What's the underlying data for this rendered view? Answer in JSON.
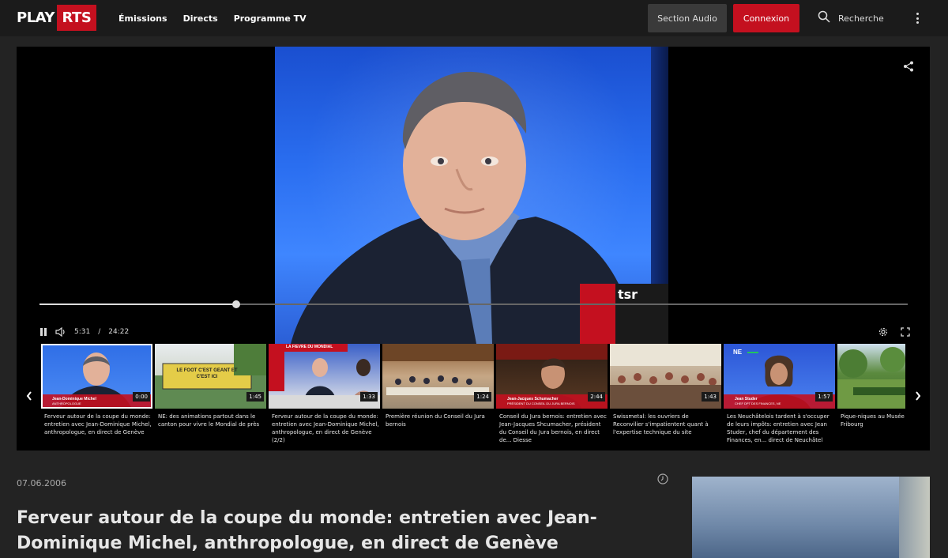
{
  "header": {
    "logo_play": "PLAY",
    "logo_rts": "RTS",
    "nav": [
      "Émissions",
      "Directs",
      "Programme TV"
    ],
    "audio_label": "Section Audio",
    "login_label": "Connexion",
    "search_label": "Recherche"
  },
  "player": {
    "time_current": "5:31",
    "time_separator": "/",
    "time_total": "24:22",
    "progress": 0.227,
    "channel_logo": "tsr"
  },
  "carousel": [
    {
      "title": "Ferveur autour de la coupe du monde: entretien avec Jean-Dominique Michel, anthropologue, en direct de Genève",
      "duration": "0:00",
      "lower_third": "Jean-Dominique Michel",
      "lower_third_sub": "ANTHROPOLOGUE",
      "active": true
    },
    {
      "title": "NE: des animations partout dans le canton pour vivre le Mondial de près",
      "duration": "1:45",
      "banner": "LE FOOT C'EST GEANT ET C'EST ICI"
    },
    {
      "title": "Ferveur autour de la coupe du monde: entretien avec Jean-Dominique Michel, anthropologue, en direct de Genève (2/2)",
      "duration": "1:33",
      "banner": "LA FIEVRE DU MONDIAL"
    },
    {
      "title": "Première réunion du Conseil du Jura bernois",
      "duration": "1:24"
    },
    {
      "title": "Conseil du Jura bernois: entretien avec Jean-Jacques Shcumacher, président du Conseil du Jura bernois, en direct de... Diesse",
      "duration": "2:44",
      "lower_third": "Jean-Jacques Schumacher",
      "lower_third_sub": "PRÉSIDENT DU CONSEIL DU JURA BERNOIS"
    },
    {
      "title": "Swissmetal: les ouvriers de Reconvilier s'impatientent quant à l'expertise technique du site",
      "duration": "1:43"
    },
    {
      "title": "Les Neuchâtelois tardent à s'occuper de leurs impôts: entretien avec Jean Studer, chef du département des Finances, en... direct de Neuchâtel",
      "duration": "1:57",
      "lower_third": "Jean Studer",
      "lower_third_sub": "CHEF DPT DES FINANCES, NE",
      "badge": "NE"
    },
    {
      "title": "Pique-niques au Musée d'Histoire de Fribourg",
      "duration": ""
    }
  ],
  "details": {
    "date": "07.06.2006",
    "title": "Ferveur autour de la coupe du monde: entretien avec Jean-Dominique Michel, anthropologue, en direct de Genève"
  },
  "colors": {
    "brand": "#c4101f",
    "background": "#232323",
    "header": "#1b1b1b"
  },
  "icons": [
    "search-icon",
    "kebab-menu-icon",
    "share-icon",
    "pause-icon",
    "volume-icon",
    "settings-icon",
    "fullscreen-icon",
    "chevron-left-icon",
    "chevron-right-icon",
    "clock-icon"
  ]
}
